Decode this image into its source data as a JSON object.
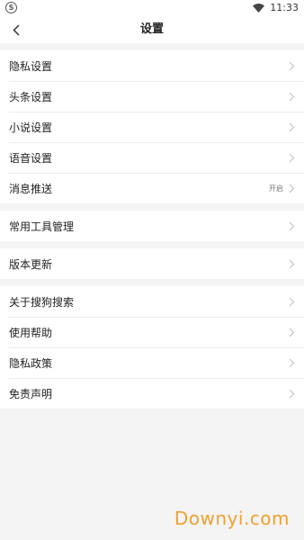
{
  "status_bar": {
    "app_icon_letter": "S",
    "time": "11:33"
  },
  "header": {
    "title": "设置",
    "back_icon": "chevron-left-icon"
  },
  "groups": [
    {
      "items": [
        {
          "label": "隐私设置",
          "value": ""
        },
        {
          "label": "头条设置",
          "value": ""
        },
        {
          "label": "小说设置",
          "value": ""
        },
        {
          "label": "语音设置",
          "value": ""
        },
        {
          "label": "消息推送",
          "value": "开启"
        }
      ]
    },
    {
      "items": [
        {
          "label": "常用工具管理",
          "value": ""
        }
      ]
    },
    {
      "items": [
        {
          "label": "版本更新",
          "value": ""
        }
      ]
    },
    {
      "items": [
        {
          "label": "关于搜狗搜索",
          "value": ""
        },
        {
          "label": "使用帮助",
          "value": ""
        },
        {
          "label": "隐私政策",
          "value": ""
        },
        {
          "label": "免责声明",
          "value": ""
        }
      ]
    }
  ],
  "watermark": "Downyi.com",
  "colors": {
    "background": "#f4f4f4",
    "row_background": "#ffffff",
    "watermark": "#f0a030",
    "chevron": "#c4c4c4"
  }
}
